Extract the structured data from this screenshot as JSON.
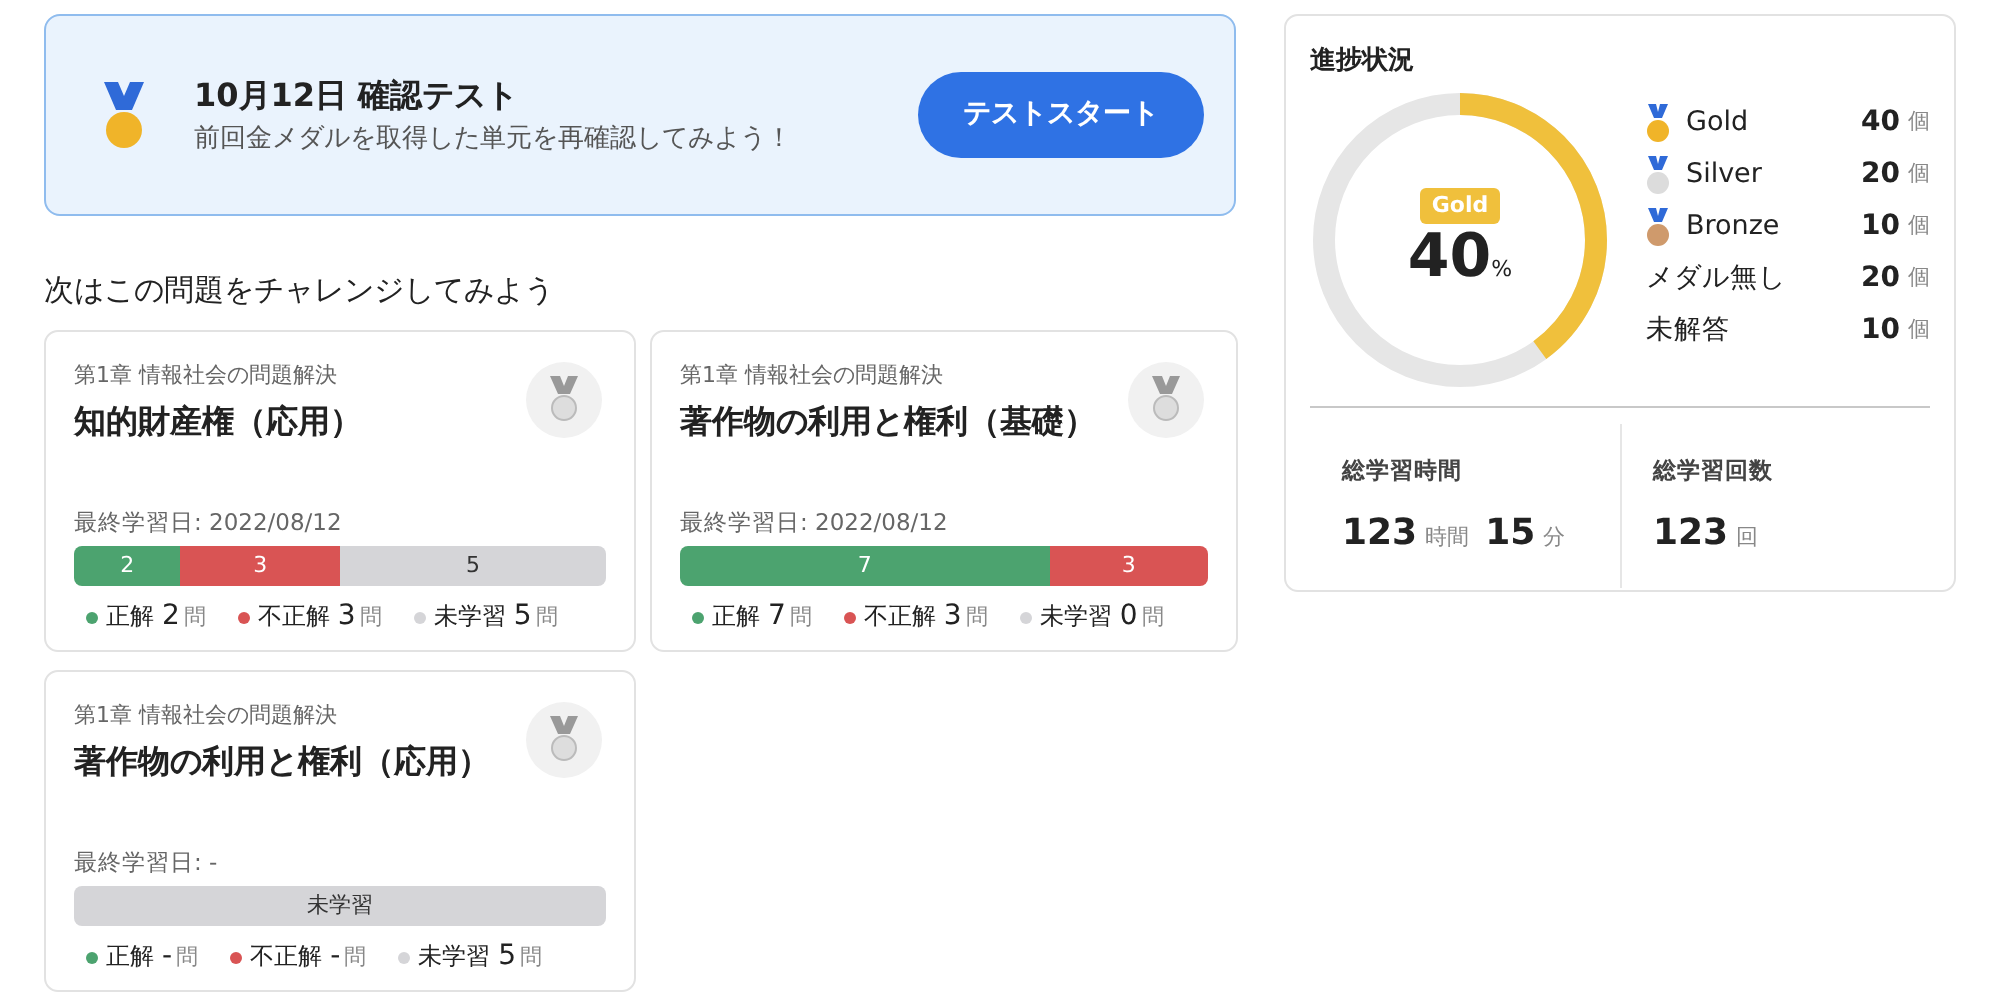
{
  "banner": {
    "title": "10月12日 確認テスト",
    "subtitle": "前回金メダルを取得した単元を再確認してみよう！",
    "button": "テストスタート"
  },
  "section_title": "次はこの問題をチャレンジしてみよう",
  "cards": [
    {
      "chapter": "第1章 情報社会の問題解決",
      "title": "知的財産権（応用）",
      "last_studied": "最終学習日: 2022/08/12",
      "segments": [
        {
          "kind": "correct",
          "label": "2"
        },
        {
          "kind": "wrong",
          "label": "3"
        },
        {
          "kind": "unlearned",
          "label": "5"
        }
      ],
      "legend": [
        {
          "kind": "correct",
          "label": "正解",
          "count": "2",
          "unit": "問"
        },
        {
          "kind": "wrong",
          "label": "不正解",
          "count": "3",
          "unit": "問"
        },
        {
          "kind": "unlearned",
          "label": "未学習",
          "count": "5",
          "unit": "問"
        }
      ]
    },
    {
      "chapter": "第1章 情報社会の問題解決",
      "title": "著作物の利用と権利（基礎）",
      "last_studied": "最終学習日: 2022/08/12",
      "segments": [
        {
          "kind": "correct",
          "label": "7"
        },
        {
          "kind": "wrong",
          "label": "3"
        }
      ],
      "legend": [
        {
          "kind": "correct",
          "label": "正解",
          "count": "7",
          "unit": "問"
        },
        {
          "kind": "wrong",
          "label": "不正解",
          "count": "3",
          "unit": "問"
        },
        {
          "kind": "unlearned",
          "label": "未学習",
          "count": "0",
          "unit": "問"
        }
      ]
    },
    {
      "chapter": "第1章 情報社会の問題解決",
      "title": "著作物の利用と権利（応用）",
      "last_studied": "最終学習日: -",
      "segments": [
        {
          "kind": "unlearned",
          "label": "未学習"
        }
      ],
      "legend": [
        {
          "kind": "correct",
          "label": "正解",
          "count": "-",
          "unit": "問"
        },
        {
          "kind": "wrong",
          "label": "不正解",
          "count": "-",
          "unit": "問"
        },
        {
          "kind": "unlearned",
          "label": "未学習",
          "count": "5",
          "unit": "問"
        }
      ]
    }
  ],
  "progress": {
    "title": "進捗状況",
    "badge": "Gold",
    "value": "40",
    "unit": "%",
    "medals": [
      {
        "kind": "gold",
        "label": "Gold",
        "count": "40",
        "unit": "個"
      },
      {
        "kind": "silver",
        "label": "Silver",
        "count": "20",
        "unit": "個"
      },
      {
        "kind": "bronze",
        "label": "Bronze",
        "count": "10",
        "unit": "個"
      },
      {
        "kind": "none",
        "label": "メダル無し",
        "count": "20",
        "unit": "個"
      },
      {
        "kind": "none",
        "label": "未解答",
        "count": "10",
        "unit": "個"
      }
    ],
    "stats": [
      {
        "label": "総学習時間",
        "parts": [
          {
            "value": "123",
            "unit": "時間"
          },
          {
            "value": "15",
            "unit": "分"
          }
        ]
      },
      {
        "label": "総学習回数",
        "parts": [
          {
            "value": "123",
            "unit": "回"
          }
        ]
      }
    ]
  }
}
